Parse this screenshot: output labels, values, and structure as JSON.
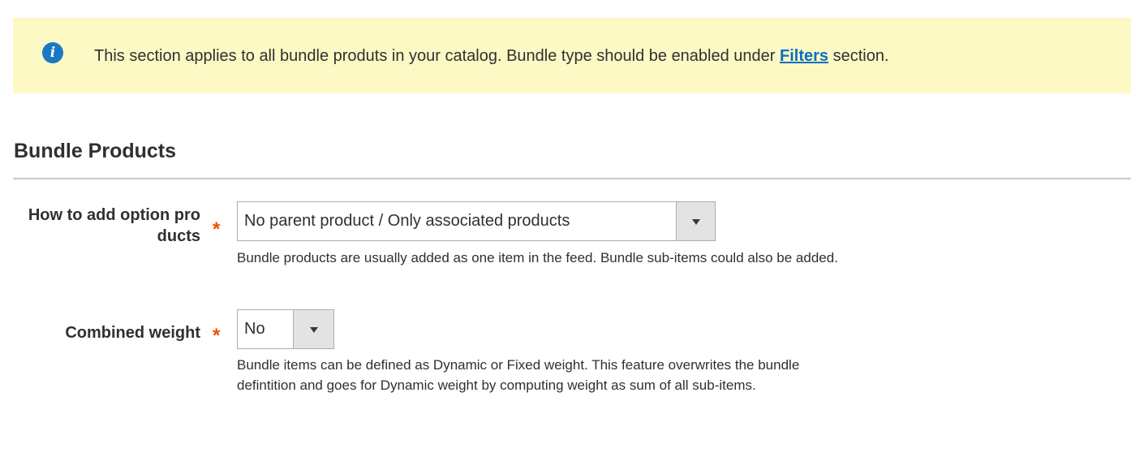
{
  "notice": {
    "icon": "info-icon",
    "text_before": "This section applies to all bundle produts in your catalog. Bundle type should be enabled under ",
    "link_text": "Filters",
    "text_after": " section."
  },
  "section": {
    "title": "Bundle Products"
  },
  "fields": {
    "option_products": {
      "label_line1": "How to add option pro",
      "label_line2": "ducts",
      "required_mark": "*",
      "value": "No parent product / Only associated products",
      "note": "Bundle products are usually added as one item in the feed. Bundle sub-items could also be added."
    },
    "combined_weight": {
      "label": "Combined weight",
      "required_mark": "*",
      "value": "No",
      "note_line1": "Bundle items can be defined as Dynamic or Fixed weight. This feature overwrites the bundle",
      "note_line2": "defintition and goes for Dynamic weight by computing weight as sum of all sub-items."
    }
  },
  "colors": {
    "notice_bg": "#fdf9c5",
    "info_icon": "#1979c3",
    "link": "#0a6fc2",
    "required": "#eb5202",
    "divider": "#cdc9c0"
  }
}
